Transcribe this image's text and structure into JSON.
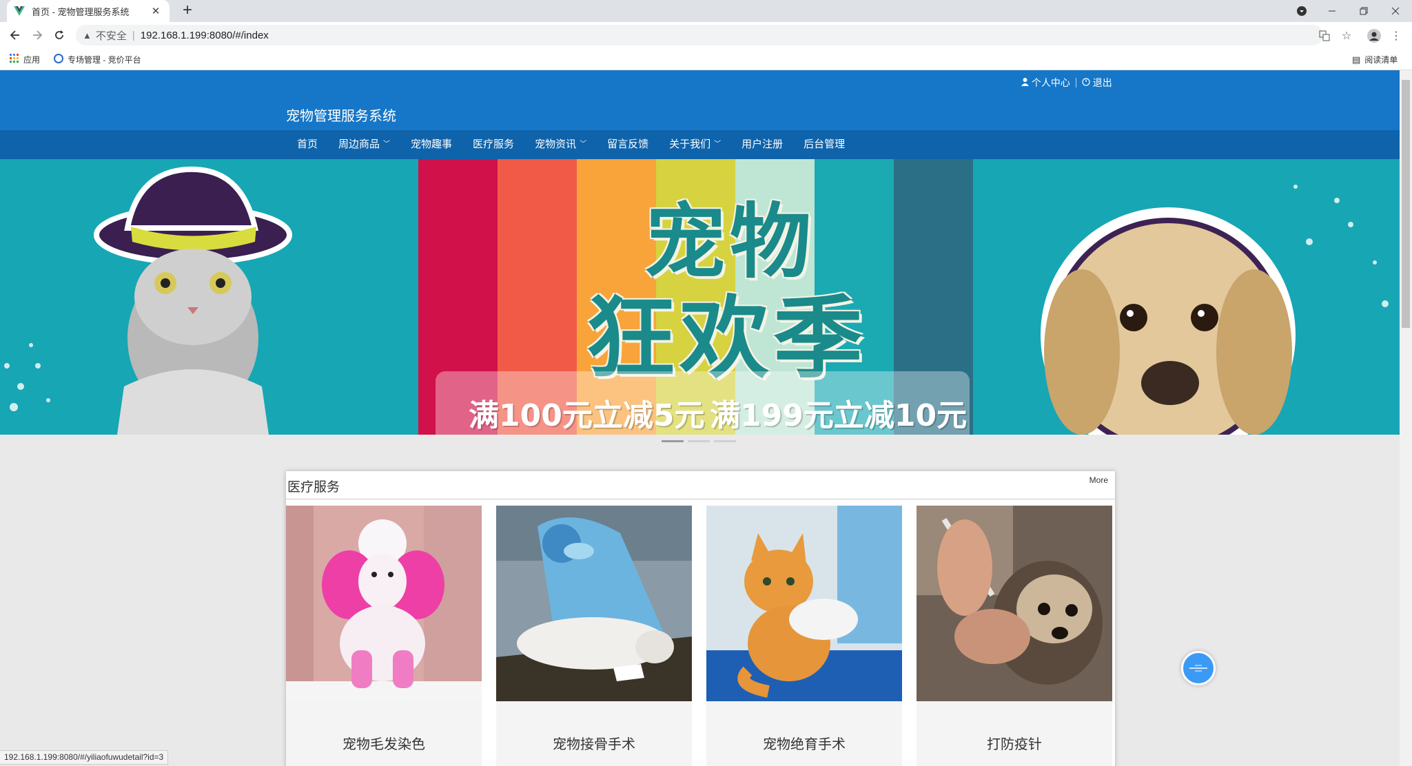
{
  "browser": {
    "tab_title": "首页 - 宠物管理服务系统",
    "tab_close": "✕",
    "new_tab": "+",
    "insecure_label": "不安全",
    "address_sep": "|",
    "url": "192.168.1.199:8080/#/index",
    "bookmarks": [
      {
        "label": "应用"
      },
      {
        "label": "专场管理 - 竞价平台"
      }
    ],
    "reading_list": "阅读清单",
    "status_url": "192.168.1.199:8080/#/yiliaofuwudetail?id=3"
  },
  "header": {
    "site_title": "宠物管理服务系统",
    "user_center": "个人中心",
    "logout": "退出"
  },
  "nav": {
    "items": [
      {
        "label": "首页",
        "dropdown": false
      },
      {
        "label": "周边商品",
        "dropdown": true
      },
      {
        "label": "宠物趣事",
        "dropdown": false
      },
      {
        "label": "医疗服务",
        "dropdown": false
      },
      {
        "label": "宠物资讯",
        "dropdown": true
      },
      {
        "label": "留言反馈",
        "dropdown": false
      },
      {
        "label": "关于我们",
        "dropdown": true
      },
      {
        "label": "用户注册",
        "dropdown": false
      },
      {
        "label": "后台管理",
        "dropdown": false
      }
    ]
  },
  "banner": {
    "line1": "宠物",
    "line2": "狂欢季",
    "promo1": "满100元立减5元",
    "promo2": "满199元立减10元",
    "active_slide": 1,
    "slide_count": 3
  },
  "section": {
    "title": "医疗服务",
    "more": "More",
    "cards": [
      {
        "name": "宠物毛发染色"
      },
      {
        "name": "宠物接骨手术"
      },
      {
        "name": "宠物绝育手术"
      },
      {
        "name": "打防疫针"
      }
    ]
  },
  "colors": {
    "header_bg": "#1677c8",
    "nav_bg": "#0f63aa",
    "banner_bg": "#17a6b4",
    "page_bg": "#e9e9e9"
  }
}
